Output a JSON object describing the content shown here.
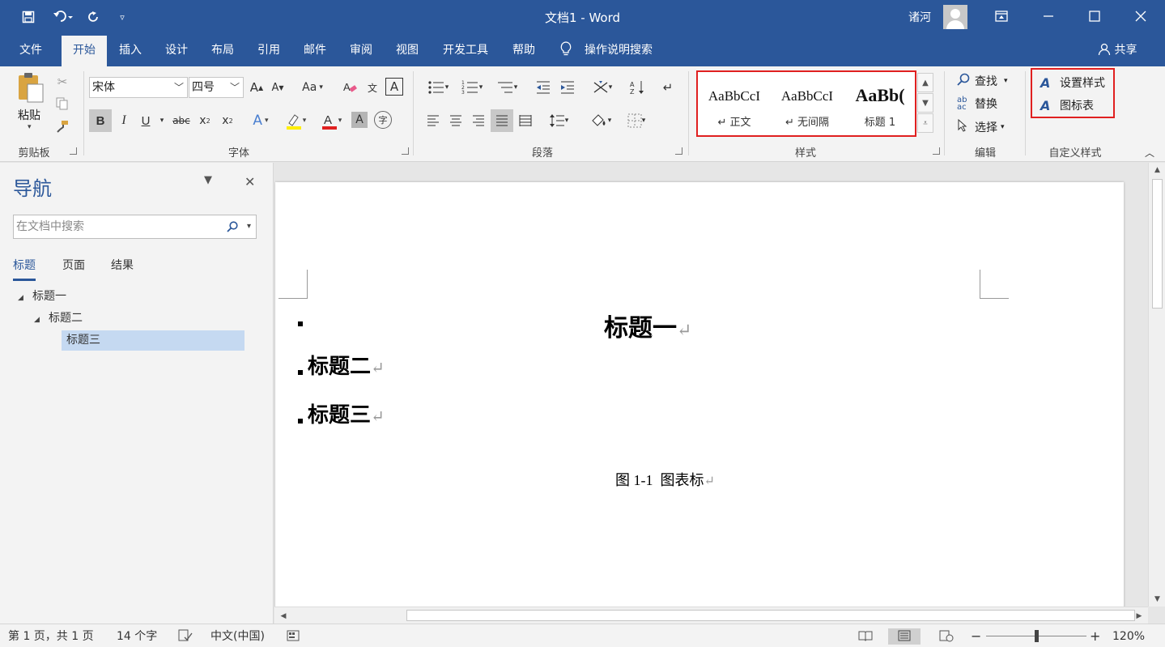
{
  "app": {
    "title": "文档1  -  Word",
    "user_name": "诸河"
  },
  "quick_access": {
    "save_icon": "save-icon",
    "undo_icon": "undo-icon",
    "redo_icon": "redo-icon",
    "customize_icon": "customize-icon"
  },
  "menu_tabs": [
    {
      "label": "文件",
      "active": false
    },
    {
      "label": "开始",
      "active": true
    },
    {
      "label": "插入",
      "active": false
    },
    {
      "label": "设计",
      "active": false
    },
    {
      "label": "布局",
      "active": false
    },
    {
      "label": "引用",
      "active": false
    },
    {
      "label": "邮件",
      "active": false
    },
    {
      "label": "审阅",
      "active": false
    },
    {
      "label": "视图",
      "active": false
    },
    {
      "label": "开发工具",
      "active": false
    },
    {
      "label": "帮助",
      "active": false
    }
  ],
  "tell_me": "操作说明搜索",
  "share": "共享",
  "ribbon": {
    "clipboard": {
      "label": "剪贴板",
      "paste": "粘贴"
    },
    "font": {
      "label": "字体",
      "font_name": "宋体",
      "font_size": "四号",
      "change_case": "Aa",
      "bold": "B",
      "italic": "I",
      "underline": "U",
      "strike": "abc"
    },
    "paragraph": {
      "label": "段落"
    },
    "styles": {
      "label": "样式",
      "items": [
        {
          "sample": "AaBbCcI",
          "name": "↵ 正文"
        },
        {
          "sample": "AaBbCcI",
          "name": "↵ 无间隔"
        },
        {
          "sample": "AaBb(",
          "name": "标题 1"
        }
      ]
    },
    "editing": {
      "label": "编辑",
      "find": "查找",
      "replace": "替换",
      "select": "选择"
    },
    "custom_styles": {
      "label": "自定义样式",
      "set_style": "设置样式",
      "figure_table": "图标表"
    }
  },
  "navigation": {
    "title": "导航",
    "search_placeholder": "在文档中搜索",
    "tabs": [
      {
        "label": "标题",
        "active": true
      },
      {
        "label": "页面",
        "active": false
      },
      {
        "label": "结果",
        "active": false
      }
    ],
    "tree": [
      {
        "label": "标题一",
        "level": 1,
        "selected": false
      },
      {
        "label": "标题二",
        "level": 2,
        "selected": false
      },
      {
        "label": "标题三",
        "level": 3,
        "selected": true
      }
    ]
  },
  "document": {
    "heading1": "标题一",
    "heading2": "标题二",
    "heading3": "标题三",
    "caption": "图 1-1  图表标",
    "para_mark": "↵"
  },
  "status": {
    "page": "第 1 页，共 1 页",
    "words": "14 个字",
    "language": "中文(中国)",
    "zoom_minus": "−",
    "zoom_plus": "+",
    "zoom": "120%",
    "zoom_fraction": 0.5
  },
  "colors": {
    "brand": "#2b579a",
    "highlight_box": "#e02020",
    "selection": "#c5d9f1"
  }
}
